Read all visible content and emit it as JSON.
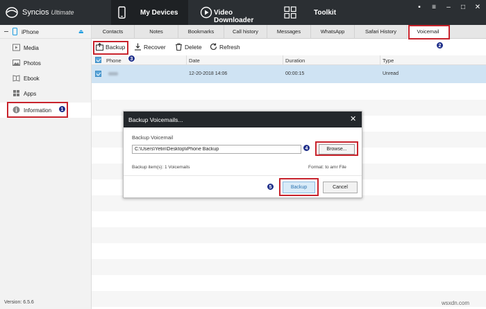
{
  "app": {
    "brand": "Syncios",
    "edition": "Ultimate"
  },
  "nav": {
    "my_devices": "My Devices",
    "video_downloader": "Video Downloader",
    "toolkit": "Toolkit"
  },
  "sidebar": {
    "device": "iPhone",
    "items": [
      {
        "label": "Media"
      },
      {
        "label": "Photos"
      },
      {
        "label": "Ebook"
      },
      {
        "label": "Apps"
      },
      {
        "label": "Information"
      }
    ],
    "version": "Version: 6.5.6"
  },
  "subtabs": [
    "Contacts",
    "Notes",
    "Bookmarks",
    "Call history",
    "Messages",
    "WhatsApp",
    "Safari History",
    "Voicemail"
  ],
  "toolbar": {
    "backup": "Backup",
    "recover": "Recover",
    "delete": "Delete",
    "refresh": "Refresh"
  },
  "table": {
    "headers": {
      "phone": "Phone",
      "date": "Date",
      "duration": "Duration",
      "type": "Type"
    },
    "row": {
      "date": "12-20-2018 14:06",
      "duration": "00:00:15",
      "type": "Unread"
    }
  },
  "dialog": {
    "title": "Backup Voicemails...",
    "subtitle": "Backup Voicemail",
    "path": "C:\\Users\\Yetin\\Desktop\\iPhone Backup",
    "browse": "Browse...",
    "count": "Backup item(s): 1 Voicemails",
    "format": "Format: to amr File",
    "backup": "Backup",
    "cancel": "Cancel"
  },
  "badges": [
    "1",
    "2",
    "3",
    "4",
    "5"
  ],
  "watermark": "wsxdn.com",
  "colors": {
    "annotation": "#c8232c",
    "badge": "#1f2f8a",
    "accent": "#1a9be0",
    "selected_row": "#cfe3f3"
  }
}
